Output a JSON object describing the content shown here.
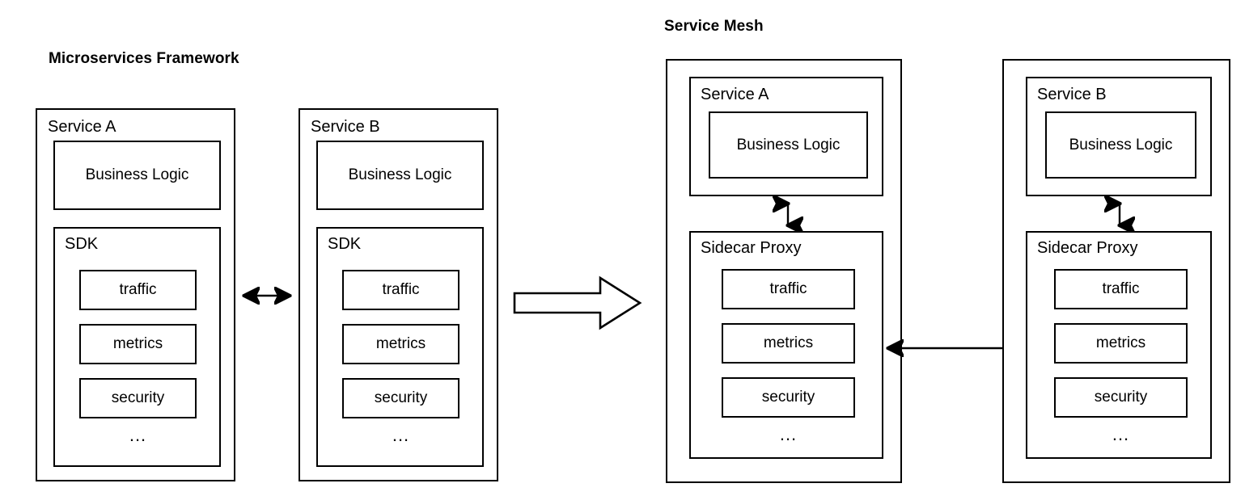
{
  "diagram": {
    "title_left": "Microservices Framework",
    "title_right": "Service Mesh",
    "capability_labels": [
      "traffic",
      "metrics",
      "security"
    ],
    "ellipsis": "...",
    "line_color": "#000000",
    "background_color": "#ffffff"
  },
  "left_panel": {
    "title": "Microservices Framework",
    "services": [
      {
        "name": "Service A",
        "business_logic_label": "Business Logic",
        "sdk_label": "SDK",
        "sdk_items": [
          "traffic",
          "metrics",
          "security"
        ],
        "sdk_more": "..."
      },
      {
        "name": "Service B",
        "business_logic_label": "Business Logic",
        "sdk_label": "SDK",
        "sdk_items": [
          "traffic",
          "metrics",
          "security"
        ],
        "sdk_more": "..."
      }
    ],
    "connector": {
      "type": "bidirectional-arrow",
      "orientation": "horizontal",
      "from": "Service A",
      "to": "Service B"
    }
  },
  "transition_arrow": {
    "type": "block-arrow",
    "direction": "right",
    "from": "Microservices Framework",
    "to": "Service Mesh"
  },
  "right_panel": {
    "title": "Service Mesh",
    "pods": [
      {
        "service_name": "Service A",
        "business_logic_label": "Business Logic",
        "proxy_label": "Sidecar Proxy",
        "proxy_items": [
          "traffic",
          "metrics",
          "security"
        ],
        "proxy_more": "...",
        "internal_connector": {
          "type": "bidirectional-arrow",
          "orientation": "vertical",
          "from": "Service A",
          "to": "Sidecar Proxy"
        }
      },
      {
        "service_name": "Service B",
        "business_logic_label": "Business Logic",
        "proxy_label": "Sidecar Proxy",
        "proxy_items": [
          "traffic",
          "metrics",
          "security"
        ],
        "proxy_more": "...",
        "internal_connector": {
          "type": "bidirectional-arrow",
          "orientation": "vertical",
          "from": "Service B",
          "to": "Sidecar Proxy"
        }
      }
    ],
    "connector": {
      "type": "bidirectional-arrow",
      "orientation": "horizontal",
      "from": "Sidecar Proxy (Service A)",
      "to": "Sidecar Proxy (Service B)"
    }
  }
}
